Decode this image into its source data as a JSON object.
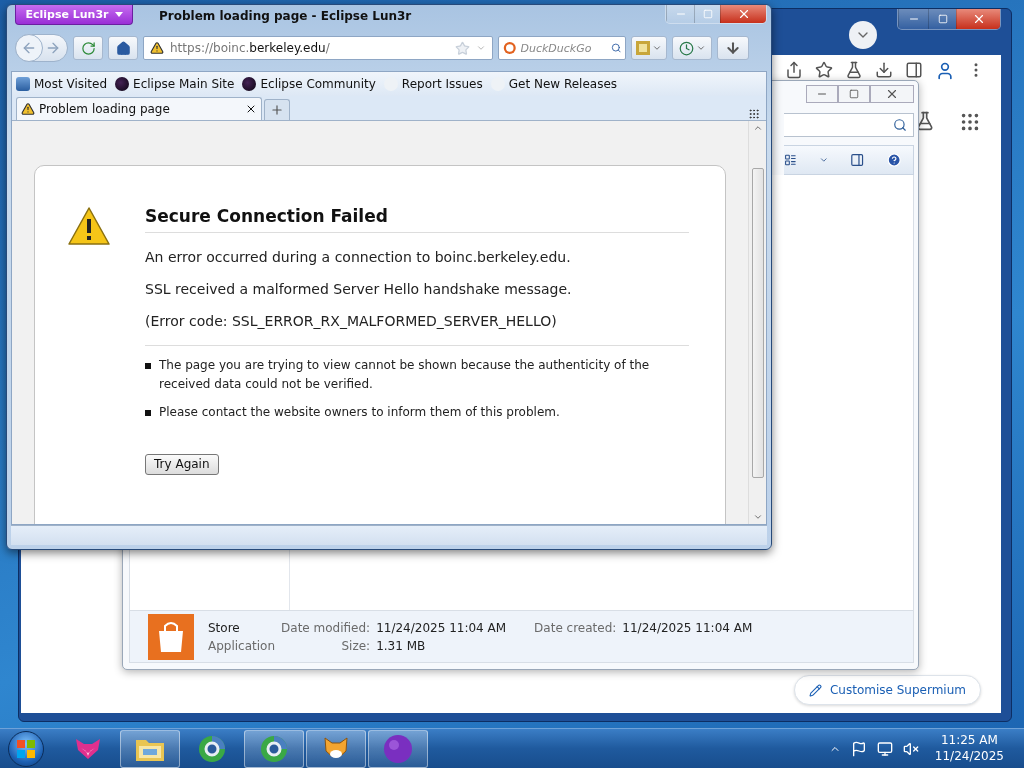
{
  "background_browser": {
    "customise_button": "Customise Supermium"
  },
  "explorer": {
    "details": {
      "name": "Store",
      "type": "Application",
      "modified_label": "Date modified:",
      "modified": "11/24/2025 11:04 AM",
      "created_label": "Date created:",
      "created": "11/24/2025 11:04 AM",
      "size_label": "Size:",
      "size": "1.31 MB"
    }
  },
  "firefox": {
    "app_menu": "Eclipse Lun3r",
    "title": "Problem loading page - Eclipse Lun3r",
    "url": {
      "prefix": "https://boinc.",
      "domain": "berkeley.edu",
      "path": "/"
    },
    "search": {
      "placeholder": "DuckDuckGo"
    },
    "bookmarks": [
      {
        "label": "Most Visited",
        "kind": "page"
      },
      {
        "label": "Eclipse Main Site",
        "kind": "eclipse"
      },
      {
        "label": "Eclipse Community",
        "kind": "eclipse"
      },
      {
        "label": "Report Issues",
        "kind": "blank"
      },
      {
        "label": "Get New Releases",
        "kind": "blank"
      }
    ],
    "tabs": [
      {
        "label": "Problem loading page",
        "selected": true
      }
    ],
    "error": {
      "title": "Secure Connection Failed",
      "paragraphs": [
        "An error occurred during a connection to boinc.berkeley.edu.",
        "SSL received a malformed Server Hello handshake message.",
        "(Error code: SSL_ERROR_RX_MALFORMED_SERVER_HELLO)"
      ],
      "bullets": [
        "The page you are trying to view cannot be shown because the authenticity of the received data could not be verified.",
        "Please contact the website owners to inform them of this problem."
      ],
      "button": "Try Again"
    }
  },
  "taskbar": {
    "items": [
      {
        "kind": "fox",
        "running": false
      },
      {
        "kind": "folder",
        "running": true
      },
      {
        "kind": "browser",
        "running": false
      },
      {
        "kind": "browser",
        "running": true
      },
      {
        "kind": "cat",
        "running": true
      },
      {
        "kind": "orb",
        "running": true
      }
    ],
    "clock": {
      "time": "11:25 AM",
      "date": "11/24/2025"
    }
  }
}
